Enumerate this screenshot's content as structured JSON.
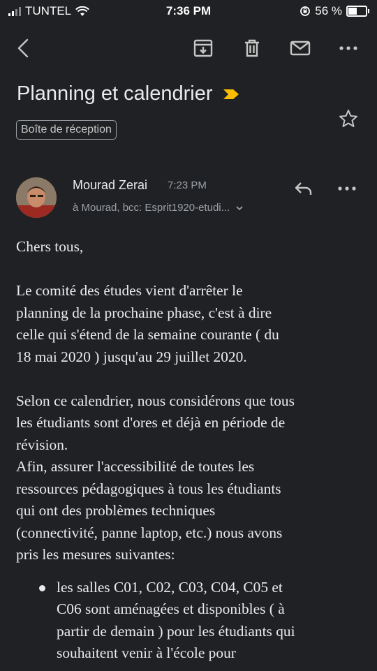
{
  "status_bar": {
    "carrier": "TUNTEL",
    "time": "7:36 PM",
    "battery": "56 %",
    "battery_level": 0.56
  },
  "toolbar": {
    "back": "back-icon",
    "archive": "archive-icon",
    "delete": "delete-icon",
    "mark_unread": "mail-icon",
    "more": "more-icon"
  },
  "email": {
    "subject": "Planning et calendrier",
    "label": "Boîte de réception",
    "sender_name": "Mourad Zerai",
    "sent_time": "7:23 PM",
    "recipients": "à Mourad, bcc: Esprit1920-etudi...",
    "body": {
      "greeting": "Chers tous,",
      "p1_lines": [
        "Le comité des études vient d'arrêter le",
        "planning de la prochaine phase, c'est à dire",
        "celle qui s'étend de la semaine courante ( du",
        "18 mai 2020 ) jusqu'au 29 juillet 2020."
      ],
      "p2_lines": [
        "Selon ce calendrier, nous considérons que tous",
        "les étudiants sont d'ores et déjà en période de",
        "révision.",
        "Afin, assurer l'accessibilité de toutes les",
        "ressources pédagogiques à tous les étudiants",
        "qui ont des problèmes techniques",
        "(connectivité, panne laptop, etc.) nous avons",
        "pris les mesures suivantes:"
      ],
      "bullet_lines": [
        "les salles C01, C02, C03, C04, C05 et",
        "C06 sont aménagées et disponibles ( à",
        "partir de demain ) pour les étudiants qui",
        "souhaitent venir à l'école pour"
      ]
    }
  },
  "colors": {
    "background": "#202124",
    "text": "#e8eaed",
    "secondary": "#9aa0a6",
    "important_marker": "#fbbc04"
  }
}
